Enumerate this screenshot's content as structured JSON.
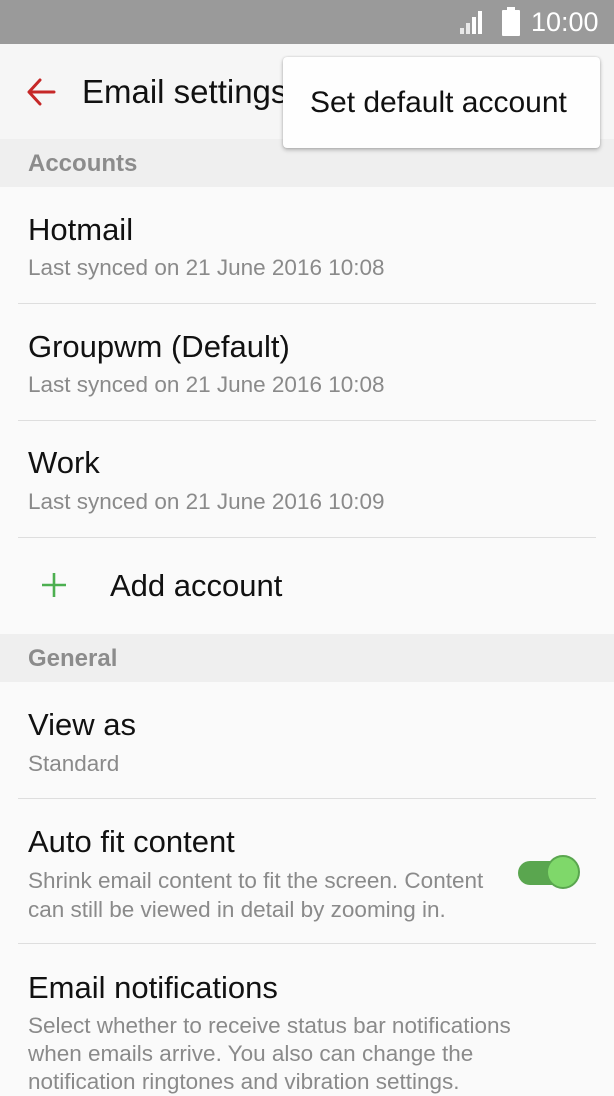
{
  "status_bar": {
    "time": "10:00"
  },
  "app_bar": {
    "title": "Email settings"
  },
  "overflow_menu": {
    "items": [
      {
        "label": "Set default account"
      }
    ]
  },
  "sections": {
    "accounts": "Accounts",
    "general": "General"
  },
  "accounts": [
    {
      "name": "Hotmail",
      "synced": "Last synced on 21 June 2016  10:08"
    },
    {
      "name": "Groupwm (Default)",
      "synced": "Last synced on 21 June 2016  10:08"
    },
    {
      "name": "Work",
      "synced": "Last synced on 21 June 2016  10:09"
    }
  ],
  "add_account": {
    "label": "Add account"
  },
  "general": {
    "view_as": {
      "title": "View as",
      "value": "Standard"
    },
    "auto_fit": {
      "title": "Auto fit content",
      "desc_line1": "Shrink email content to fit the screen. Content",
      "desc_line2": "can still be viewed in detail by zooming in.",
      "enabled": true
    },
    "notifications": {
      "title": "Email notifications",
      "desc_line1": "Select whether to receive status bar notifications",
      "desc_line2": "when emails arrive. You also can change the",
      "desc_line3": "notification ringtones and vibration settings."
    }
  },
  "colors": {
    "accent_red": "#c62828",
    "accent_green": "#4caf50",
    "toggle_on": "#5aa64f"
  }
}
